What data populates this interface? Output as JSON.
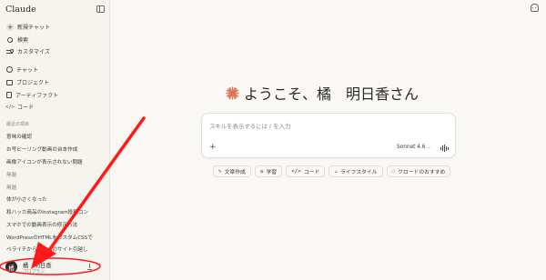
{
  "app": {
    "title": "Claude"
  },
  "sidebar": {
    "primary": [
      {
        "label": "新規チャット",
        "icon": "plus-circle-icon"
      },
      {
        "label": "検索",
        "icon": "search-icon"
      },
      {
        "label": "カスタマイズ",
        "icon": "sliders-icon"
      }
    ],
    "secondary": [
      {
        "label": "チャット",
        "icon": "chat-icon"
      },
      {
        "label": "プロジェクト",
        "icon": "project-icon"
      },
      {
        "label": "アーティファクト",
        "icon": "artifact-icon"
      },
      {
        "label": "コード",
        "icon": "code-icon"
      }
    ],
    "recents_title": "最近の項目",
    "recents": [
      "意味の確認",
      "お号ヒーリング動画の台本作成",
      "画像アイコンが表示されない問題",
      "無題",
      "無題",
      "体が小さくなった",
      "和ハッカ商品のInstagram投稿コン",
      "スマホでの動画表示の修正方法",
      "WordPressのHTMLをカスタムCSSで",
      "ペライチからTCDへのサイト引越し"
    ],
    "user": {
      "avatar_initial": "橘",
      "name": "橘　明日香",
      "plan": "プロプラン"
    }
  },
  "main": {
    "greeting": "ようこそ、橘　明日香さん",
    "composer": {
      "placeholder": "スキルを表示するには / を入力",
      "attach_glyph": "+",
      "model_label": "Sonnet 4.6",
      "model_chevron": "⌄"
    },
    "chips": [
      {
        "label": "文章作成",
        "icon": "pen-icon",
        "glyph": "✎"
      },
      {
        "label": "学習",
        "icon": "graduation-cap-icon",
        "glyph": "≡"
      },
      {
        "label": "コード",
        "icon": "code-icon",
        "glyph": "</>"
      },
      {
        "label": "ライフスタイル",
        "icon": "coffee-icon",
        "glyph": "☕"
      },
      {
        "label": "クロードのおすすめ",
        "icon": "lightbulb-icon",
        "glyph": "◌"
      }
    ]
  },
  "colors": {
    "accent": "#d97757",
    "annotation": "#ff1a1a",
    "sidebar_bg": "#f5f4ef",
    "main_bg": "#f9f8f5"
  }
}
